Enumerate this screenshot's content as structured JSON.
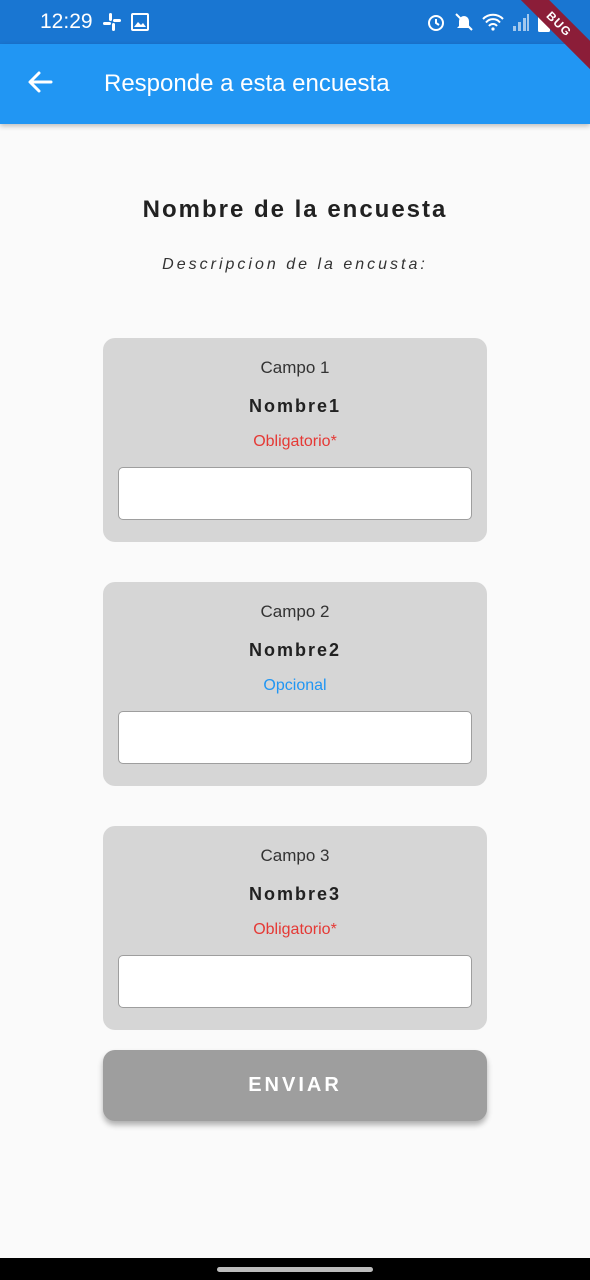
{
  "status_bar": {
    "time": "12:29",
    "left_icons": [
      "slack-icon",
      "image-icon"
    ],
    "right_icons": [
      "alarm-icon",
      "mute-icon",
      "wifi-icon",
      "signal-icon",
      "battery-icon"
    ]
  },
  "debug_banner": "BUG",
  "app_bar": {
    "title": "Responde a esta encuesta",
    "back_icon": "arrow-back-icon"
  },
  "survey": {
    "title": "Nombre de la encuesta",
    "description": "Descripcion de la encusta:"
  },
  "fields": [
    {
      "index_label": "Campo 1",
      "name": "Nombre1",
      "requirement": "Obligatorio*",
      "value": ""
    },
    {
      "index_label": "Campo 2",
      "name": "Nombre2",
      "requirement": "Opcional",
      "value": ""
    },
    {
      "index_label": "Campo 3",
      "name": "Nombre3",
      "requirement": "Obligatorio*",
      "value": ""
    }
  ],
  "submit_label": "ENVIAR",
  "colors": {
    "status_bar": "#1976d2",
    "app_bar": "#2196f3",
    "required": "#e53935",
    "optional": "#2196f3",
    "card": "#d6d6d6",
    "button_disabled": "#9e9e9e"
  }
}
